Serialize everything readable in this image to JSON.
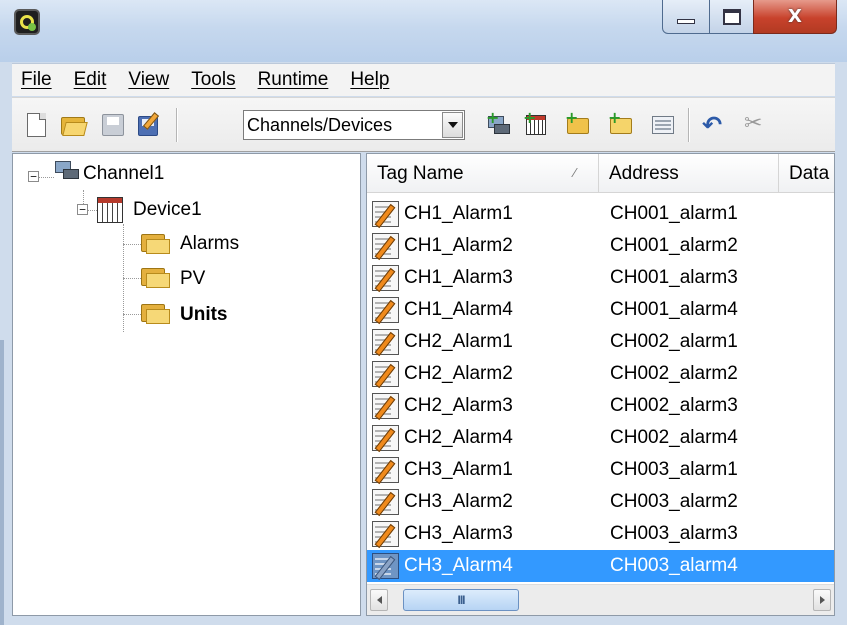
{
  "menu": [
    "File",
    "Edit",
    "View",
    "Tools",
    "Runtime",
    "Help"
  ],
  "window_controls": {
    "close_glyph": "X"
  },
  "toolbar": {
    "view_select": "Channels/Devices"
  },
  "tree": {
    "channel": "Channel1",
    "device": "Device1",
    "groups": [
      "Alarms",
      "PV",
      "Units"
    ],
    "selected_group": "Units"
  },
  "list": {
    "columns": {
      "tag_name": "Tag Name",
      "address": "Address",
      "data": "Data"
    },
    "rows": [
      {
        "tag": "CH1_Alarm1",
        "address": "CH001_alarm1"
      },
      {
        "tag": "CH1_Alarm2",
        "address": "CH001_alarm2"
      },
      {
        "tag": "CH1_Alarm3",
        "address": "CH001_alarm3"
      },
      {
        "tag": "CH1_Alarm4",
        "address": "CH001_alarm4"
      },
      {
        "tag": "CH2_Alarm1",
        "address": "CH002_alarm1"
      },
      {
        "tag": "CH2_Alarm2",
        "address": "CH002_alarm2"
      },
      {
        "tag": "CH2_Alarm3",
        "address": "CH002_alarm3"
      },
      {
        "tag": "CH2_Alarm4",
        "address": "CH002_alarm4"
      },
      {
        "tag": "CH3_Alarm1",
        "address": "CH003_alarm1"
      },
      {
        "tag": "CH3_Alarm2",
        "address": "CH003_alarm2"
      },
      {
        "tag": "CH3_Alarm3",
        "address": "CH003_alarm3"
      },
      {
        "tag": "CH3_Alarm4",
        "address": "CH003_alarm4"
      }
    ],
    "selected_row": 11,
    "scroll_grip": "III"
  },
  "colors": {
    "selection": "#3399ff",
    "titlebar": "#c6d8ee",
    "close_button": "#c8422c"
  },
  "icons": {
    "app": "app-logo-icon",
    "new": "new-file-icon",
    "open": "open-folder-icon",
    "save": "save-icon",
    "save_as": "save-as-icon",
    "new_channel": "new-channel-icon",
    "new_device": "new-device-icon",
    "new_group": "new-tag-group-icon",
    "new_tag": "new-tag-icon",
    "properties": "properties-icon",
    "undo": "undo-icon",
    "cut": "cut-icon",
    "tag": "tag-icon"
  }
}
